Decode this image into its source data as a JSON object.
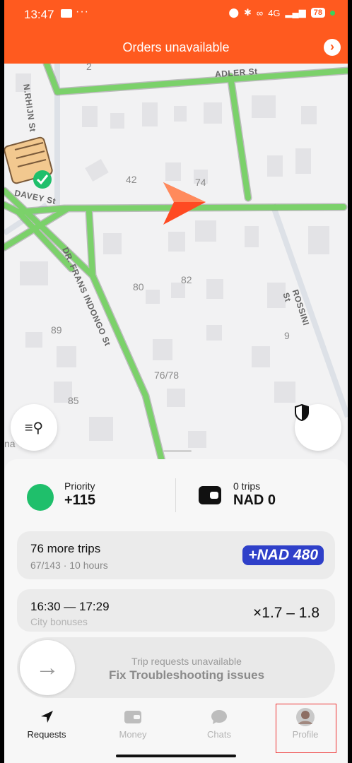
{
  "status": {
    "time": "13:47",
    "dots": "···",
    "network": "4G",
    "battery": "78"
  },
  "banner": {
    "title": "Orders unavailable"
  },
  "map": {
    "streets": [
      "ADLER St",
      "N.RHIJN St",
      "DAVEY St",
      "DR. FRANS INDONGO St",
      "ROSSINI St"
    ],
    "plot_numbers": [
      "2",
      "42",
      "74",
      "80",
      "82",
      "89",
      "9",
      "76/78",
      "85"
    ],
    "edge_text": "na"
  },
  "stats": {
    "priority": {
      "label": "Priority",
      "value": "+115"
    },
    "earnings": {
      "label": "0 trips",
      "value": "NAD 0"
    }
  },
  "goal_card": {
    "title": "76 more trips",
    "subtitle": "67/143 · 10 hours",
    "reward": "+NAD 480"
  },
  "bonus_card": {
    "time_range": "16:30 — 17:29",
    "label": "City bonuses",
    "multiplier": "×1.7 – 1.8"
  },
  "slider": {
    "status": "Trip requests unavailable",
    "action": "Fix Troubleshooting issues"
  },
  "tabs": [
    {
      "label": "Requests",
      "icon": "navigation-arrow-icon"
    },
    {
      "label": "Money",
      "icon": "wallet-icon"
    },
    {
      "label": "Chats",
      "icon": "chat-bubble-icon"
    },
    {
      "label": "Profile",
      "icon": "avatar-icon"
    }
  ],
  "colors": {
    "accent": "#ff5a1f",
    "route": "#7bd16a",
    "priority": "#1fbf6b",
    "bonus": "#2f40c9"
  }
}
